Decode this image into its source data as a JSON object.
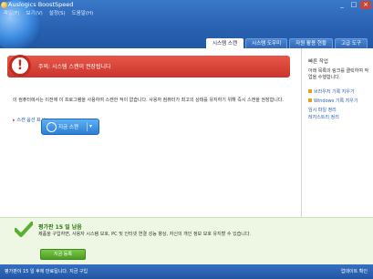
{
  "window": {
    "title": "Auslogics BoostSpeed",
    "controls": {
      "minimize": "_",
      "maximize": "□",
      "close": "×"
    }
  },
  "menu": [
    "파일(F)",
    "보기(V)",
    "설정(S)",
    "도움말(H)"
  ],
  "tabs": [
    {
      "label": "시스템 스캔",
      "active": true
    },
    {
      "label": "시스템 도우미",
      "active": false
    },
    {
      "label": "자원 활용 현황",
      "active": false
    },
    {
      "label": "고급 도구",
      "active": false
    }
  ],
  "alert": {
    "icon": "!",
    "text": "주의: 시스템 스캔이 권장됩니다"
  },
  "description": "이 컴퓨터에서는 이전에 이 프로그램을 사용하여 스캔한 적이 없습니다. 사용자 컴퓨터가 최고의 상태를 유지하기 위해 즉시 스캔을 권장합니다.",
  "scan_options_link": "스캔 옵션 표시",
  "scan_button": {
    "label": "지금 스캔",
    "dropdown": "▾"
  },
  "sidebar": {
    "title": "빠른 작업",
    "description": "아래 목록의 링크를 클릭하여 작업을 수행합니다.",
    "links": [
      "브라우저 기록 지우기",
      "Windows 기록 지우기",
      "임시 파일 정리",
      "레지스트리 정리"
    ]
  },
  "trial": {
    "title": "평가판 15 일 남음",
    "description": "제품을 구입하면, 사용자 시스템 보호, PC 및 인터넷 연결 성능 향상, 자신의 개인 정보 보호 유지할 수 있습니다.",
    "buy_button": "지금 등록"
  },
  "status_bar": {
    "left": "평가판이 15 일 후에 만료됩니다. 지금 구입",
    "right": "업데이트 확인"
  },
  "colors": {
    "header_blue": "#2a62b2",
    "alert_red": "#d43b30",
    "scan_blue": "#3a8fe0",
    "trial_green": "#2a7a10",
    "buy_green": "#5aaf2e"
  }
}
